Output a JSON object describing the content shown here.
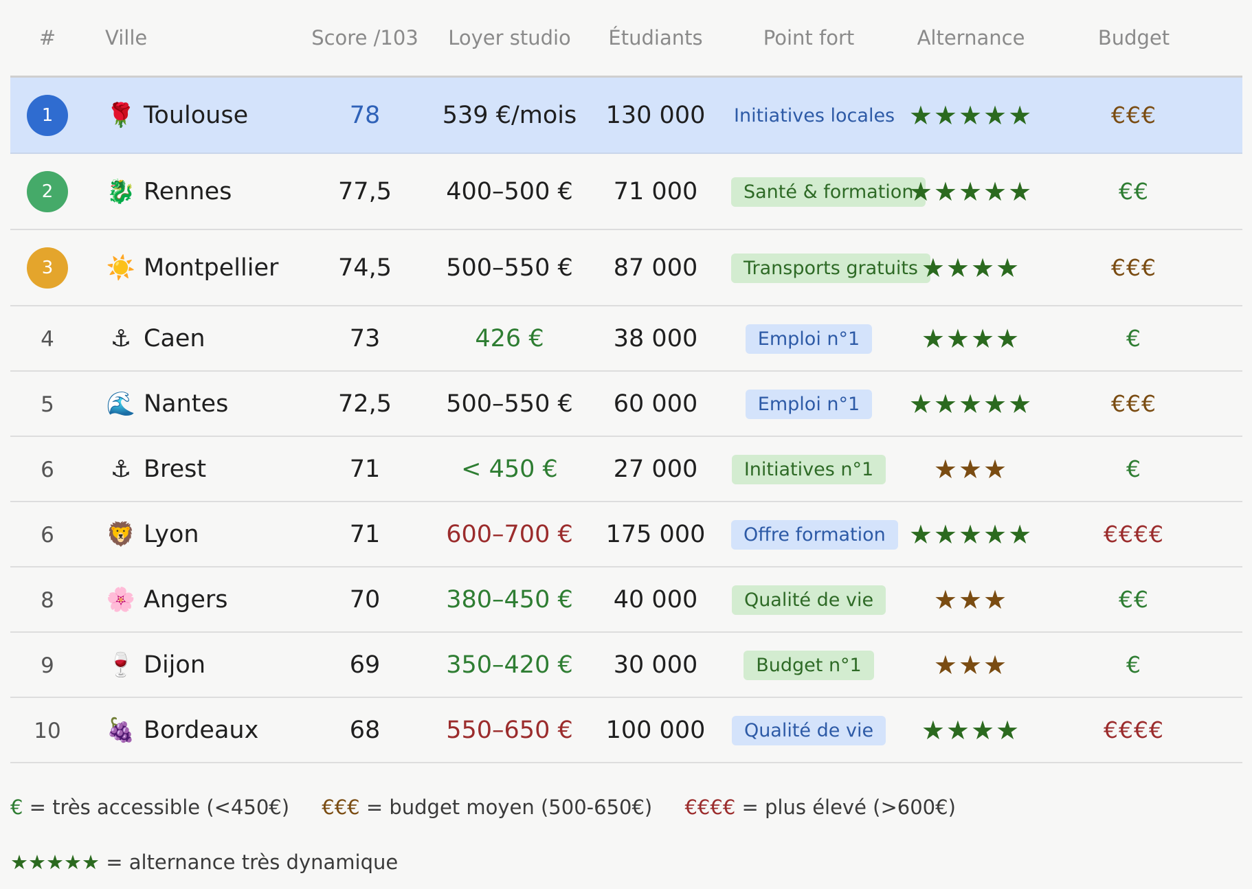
{
  "headers": {
    "rank": "#",
    "city": "Ville",
    "score": "Score /103",
    "rent": "Loyer studio",
    "students": "Étudiants",
    "strength": "Point fort",
    "alternance": "Alternance",
    "budget": "Budget"
  },
  "rows": [
    {
      "rank": "1",
      "medal": "#2f6cd0",
      "icon": "🌹",
      "icon_name": "rose-icon",
      "city": "Toulouse",
      "score": "78",
      "score_color": "#2f62b8",
      "rent": "539 €/mois",
      "rent_color": "#1f1f1f",
      "students": "130 000",
      "strength": "Initiatives locales",
      "tag_bg": "transparent",
      "tag_fg": "#2d5aa6",
      "tag_plain": true,
      "stars": "★★★★★",
      "stars_color": "#2b6a1f",
      "budget": "€€€",
      "budget_color": "#7a4c12",
      "highlight": true
    },
    {
      "rank": "2",
      "medal": "#45aa69",
      "icon": "🐉",
      "icon_name": "dragon-icon",
      "city": "Rennes",
      "score": "77,5",
      "score_color": "#1f1f1f",
      "rent": "400–500 €",
      "rent_color": "#1f1f1f",
      "students": "71 000",
      "strength": "Santé & formation",
      "tag_bg": "#d3ecd0",
      "tag_fg": "#2e6a26",
      "stars": "★★★★★",
      "stars_color": "#2b6a1f",
      "budget": "€€",
      "budget_color": "#2e7d32"
    },
    {
      "rank": "3",
      "medal": "#e4a52c",
      "icon": "☀️",
      "icon_name": "sun-icon",
      "city": "Montpellier",
      "score": "74,5",
      "score_color": "#1f1f1f",
      "rent": "500–550 €",
      "rent_color": "#1f1f1f",
      "students": "87 000",
      "strength": "Transports gratuits",
      "tag_bg": "#d3ecd0",
      "tag_fg": "#2e6a26",
      "stars": "★★★★",
      "stars_color": "#2b6a1f",
      "budget": "€€€",
      "budget_color": "#7a4c12"
    },
    {
      "rank": "4",
      "icon": "⚓",
      "icon_name": "anchor-icon",
      "city": "Caen",
      "score": "73",
      "score_color": "#1f1f1f",
      "rent": "426 €",
      "rent_color": "#2e7d32",
      "students": "38 000",
      "strength": "Emploi n°1",
      "tag_bg": "#d4e3fb",
      "tag_fg": "#2d5aa6",
      "stars": "★★★★",
      "stars_color": "#2b6a1f",
      "budget": "€",
      "budget_color": "#2e7d32"
    },
    {
      "rank": "5",
      "icon": "🌊",
      "icon_name": "wave-icon",
      "city": "Nantes",
      "score": "72,5",
      "score_color": "#1f1f1f",
      "rent": "500–550 €",
      "rent_color": "#1f1f1f",
      "students": "60 000",
      "strength": "Emploi n°1",
      "tag_bg": "#d4e3fb",
      "tag_fg": "#2d5aa6",
      "stars": "★★★★★",
      "stars_color": "#2b6a1f",
      "budget": "€€€",
      "budget_color": "#7a4c12"
    },
    {
      "rank": "6",
      "icon": "⚓",
      "icon_name": "anchor-icon",
      "city": "Brest",
      "score": "71",
      "score_color": "#1f1f1f",
      "rent": "< 450 €",
      "rent_color": "#2e7d32",
      "students": "27 000",
      "strength": "Initiatives n°1",
      "tag_bg": "#d3ecd0",
      "tag_fg": "#2e6a26",
      "stars": "★★★",
      "stars_color": "#7a4c12",
      "budget": "€",
      "budget_color": "#2e7d32"
    },
    {
      "rank": "6",
      "icon": "🦁",
      "icon_name": "lion-icon",
      "city": "Lyon",
      "score": "71",
      "score_color": "#1f1f1f",
      "rent": "600–700 €",
      "rent_color": "#9b2c2c",
      "students": "175 000",
      "strength": "Offre formation",
      "tag_bg": "#d4e3fb",
      "tag_fg": "#2d5aa6",
      "stars": "★★★★★",
      "stars_color": "#2b6a1f",
      "budget": "€€€€",
      "budget_color": "#9b2c2c"
    },
    {
      "rank": "8",
      "icon": "🌸",
      "icon_name": "flower-icon",
      "city": "Angers",
      "score": "70",
      "score_color": "#1f1f1f",
      "rent": "380–450 €",
      "rent_color": "#2e7d32",
      "students": "40 000",
      "strength": "Qualité de vie",
      "tag_bg": "#d3ecd0",
      "tag_fg": "#2e6a26",
      "stars": "★★★",
      "stars_color": "#7a4c12",
      "budget": "€€",
      "budget_color": "#2e7d32"
    },
    {
      "rank": "9",
      "icon": "🍷",
      "icon_name": "wine-glass-icon",
      "city": "Dijon",
      "score": "69",
      "score_color": "#1f1f1f",
      "rent": "350–420 €",
      "rent_color": "#2e7d32",
      "students": "30 000",
      "strength": "Budget n°1",
      "tag_bg": "#d3ecd0",
      "tag_fg": "#2e6a26",
      "stars": "★★★",
      "stars_color": "#7a4c12",
      "budget": "€",
      "budget_color": "#2e7d32"
    },
    {
      "rank": "10",
      "icon": "🍇",
      "icon_name": "grapes-icon",
      "city": "Bordeaux",
      "score": "68",
      "score_color": "#1f1f1f",
      "rent": "550–650 €",
      "rent_color": "#9b2c2c",
      "students": "100 000",
      "strength": "Qualité de vie",
      "tag_bg": "#d4e3fb",
      "tag_fg": "#2d5aa6",
      "stars": "★★★★",
      "stars_color": "#2b6a1f",
      "budget": "€€€€",
      "budget_color": "#9b2c2c"
    }
  ],
  "legend": {
    "items": [
      {
        "symbol": "€",
        "color": "#2e7d32",
        "text": " = très accessible (<450€)"
      },
      {
        "symbol": "€€€",
        "color": "#7a4c12",
        "text": " = budget moyen (500-650€)"
      },
      {
        "symbol": "€€€€",
        "color": "#9b2c2c",
        "text": " = plus élevé (>600€)"
      }
    ],
    "stars_symbol": "★★★★★",
    "stars_color": "#2b6a1f",
    "stars_text": " = alternance très dynamique"
  }
}
